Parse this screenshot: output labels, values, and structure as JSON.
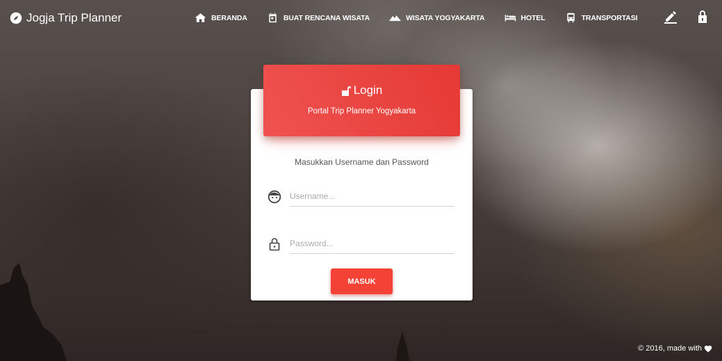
{
  "brand": {
    "title": "Jogja Trip Planner",
    "icon": "compass-icon"
  },
  "nav": {
    "items": [
      {
        "label": "BERANDA",
        "icon": "home-icon"
      },
      {
        "label": "BUAT RENCANA WISATA",
        "icon": "calendar-icon"
      },
      {
        "label": "WISATA YOGYAKARTA",
        "icon": "mountain-icon"
      },
      {
        "label": "HOTEL",
        "icon": "bed-icon"
      },
      {
        "label": "TRANSPORTASI",
        "icon": "bus-icon"
      }
    ],
    "edit_icon": "pencil-icon",
    "lock_icon": "lock-icon"
  },
  "login": {
    "title": "Login",
    "subtitle": "Portal Trip Planner Yogyakarta",
    "instruction": "Masukkan Username dan Password",
    "username_placeholder": "Username...",
    "password_placeholder": "Password...",
    "submit_label": "MASUK"
  },
  "footer": {
    "text": "© 2016, made with"
  },
  "colors": {
    "accent": "#f44336",
    "header_gradient_start": "#ef5350",
    "header_gradient_end": "#e53935"
  }
}
